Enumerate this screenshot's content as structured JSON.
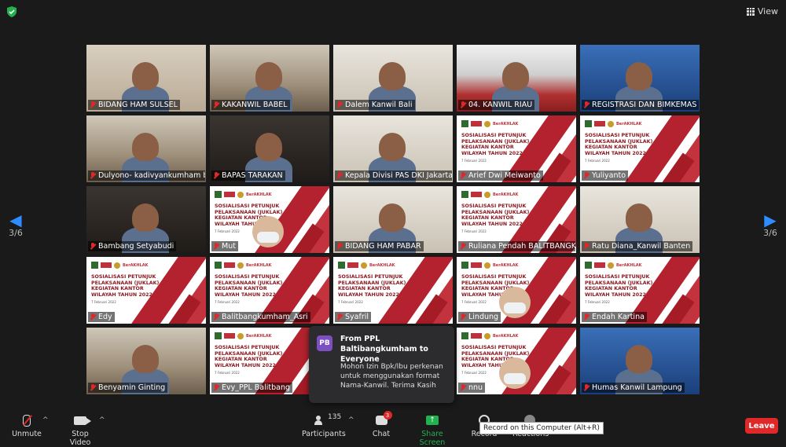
{
  "window": {
    "view_label": "View"
  },
  "navigation": {
    "page_indicator_left": "3/6",
    "page_indicator_right": "3/6"
  },
  "tiles": [
    {
      "name": "BIDANG HAM SULSEL",
      "kind": "camera"
    },
    {
      "name": "KAKANWIL BABEL",
      "kind": "camera"
    },
    {
      "name": "Dalem Kanwil Bali",
      "kind": "camera"
    },
    {
      "name": "04. KANWIL RIAU",
      "kind": "camera"
    },
    {
      "name": "REGISTRASI DAN BIMKEMAS ...",
      "kind": "camera"
    },
    {
      "name": "Dulyono- kadivyankumham b...",
      "kind": "camera"
    },
    {
      "name": "BAPAS TARAKAN",
      "kind": "camera"
    },
    {
      "name": "Kepala Divisi PAS DKI Jakarta",
      "kind": "camera"
    },
    {
      "name": "Arief Dwi Meiwanto",
      "kind": "slide"
    },
    {
      "name": "Yuliyanto",
      "kind": "slide"
    },
    {
      "name": "Bambang Setyabudi",
      "kind": "camera"
    },
    {
      "name": "Mut",
      "kind": "slide-person"
    },
    {
      "name": "BIDANG HAM PABAR",
      "kind": "camera"
    },
    {
      "name": "Ruliana Pendah BALITBANGK...",
      "kind": "slide"
    },
    {
      "name": "Ratu Diana_Kanwil Banten",
      "kind": "camera"
    },
    {
      "name": "Edy",
      "kind": "slide"
    },
    {
      "name": "Balitbangkumham_Asri",
      "kind": "slide"
    },
    {
      "name": "Syafril",
      "kind": "slide"
    },
    {
      "name": "Lindung",
      "kind": "slide-person"
    },
    {
      "name": "Endah Kartina",
      "kind": "slide"
    },
    {
      "name": "Benyamin Ginting",
      "kind": "camera"
    },
    {
      "name": "Evy_PPL Balitbang",
      "kind": "slide"
    },
    {
      "name": "",
      "kind": "slide"
    },
    {
      "name": "nnu",
      "kind": "slide-person"
    },
    {
      "name": "Humas Kanwil Lampung",
      "kind": "camera"
    }
  ],
  "slide": {
    "brand": "BerAKHLAK",
    "title": "SOSIALISASI PETUNJUK PELAKSANAAN (JUKLAK) KEGIATAN KANTOR WILAYAH TAHUN 2022",
    "date": "7 Februari 2022"
  },
  "chat_popup": {
    "avatar": "PB",
    "from": "From PPL Baltibangkumham to Everyone",
    "message": "Mohon Izin Bpk/Ibu perkenan untuk menggunakan format Nama-Kanwil. Terima Kasih"
  },
  "toolbar": {
    "unmute": "Unmute",
    "stop_video": "Stop Video",
    "participants": "Participants",
    "participant_count": "135",
    "chat": "Chat",
    "chat_badge": "3",
    "share_screen": "Share Screen",
    "record": "Record",
    "reactions": "Reactions",
    "leave": "Leave",
    "record_tooltip": "Record on this Computer (Alt+R)"
  },
  "colors": {
    "accent": "#2d8cff",
    "leave": "#e02828",
    "share": "#23b14d",
    "slide_red": "#b3222e"
  }
}
